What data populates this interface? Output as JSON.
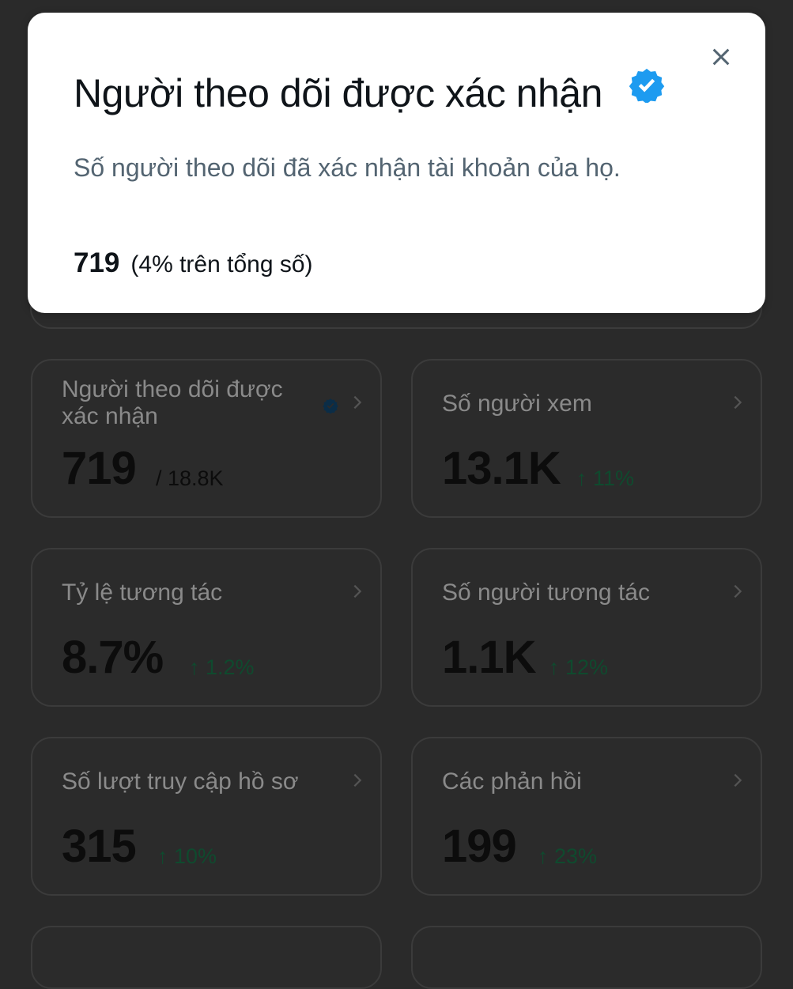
{
  "modal": {
    "title": "Người theo dõi được xác nhận",
    "description": "Số người theo dõi đã xác nhận tài khoản của họ.",
    "count": "719",
    "percent_text": "(4% trên tổng số)"
  },
  "cards": {
    "verified": {
      "title": "Người theo dõi được xác nhận",
      "value": "719",
      "sub": "/ 18.8K"
    },
    "viewers": {
      "title": "Số người xem",
      "value": "13.1K",
      "delta": "↑ 11%"
    },
    "engagement_rate": {
      "title": "Tỷ lệ tương tác",
      "value": "8.7%",
      "delta": "↑ 1.2%"
    },
    "engaged_people": {
      "title": "Số người tương tác",
      "value": "1.1K",
      "delta": "↑ 12%"
    },
    "profile_visits": {
      "title": "Số lượt truy cập hồ sơ",
      "value": "315",
      "delta": "↑ 10%"
    },
    "replies": {
      "title": "Các phản hồi",
      "value": "199",
      "delta": "↑ 23%"
    }
  },
  "colors": {
    "verified_blue": "#1d9bf0",
    "delta_green": "#00ba7c",
    "overlay": "#2a2a2a"
  }
}
